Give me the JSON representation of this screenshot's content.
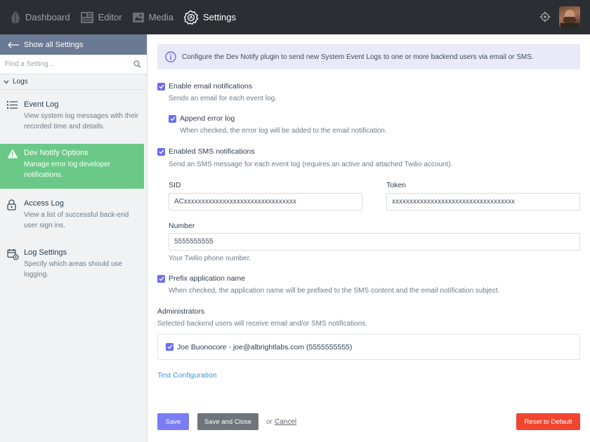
{
  "topbar": {
    "nav": [
      {
        "label": "Dashboard",
        "icon": "leaf-icon"
      },
      {
        "label": "Editor",
        "icon": "newspaper-icon"
      },
      {
        "label": "Media",
        "icon": "image-icon"
      },
      {
        "label": "Settings",
        "icon": "gear-icon"
      }
    ],
    "active_color": "#ffffff"
  },
  "sidebar": {
    "show_all": "Show all Settings",
    "search_placeholder": "Find a Setting...",
    "group": "Logs",
    "items": [
      {
        "title": "Event Log",
        "desc": "View system log messages with their recorded time and details.",
        "icon": "list-icon"
      },
      {
        "title": "Dev Notify Options",
        "desc": "Manage error log developer notifications.",
        "icon": "warning-icon",
        "active": true
      },
      {
        "title": "Access Log",
        "desc": "View a list of successful back-end user sign ins.",
        "icon": "lock-icon"
      },
      {
        "title": "Log Settings",
        "desc": "Specify which areas should use logging.",
        "icon": "calendar-gear-icon"
      }
    ],
    "active_color": "#6ac987"
  },
  "main": {
    "info": "Configure the Dev Notify plugin to send new System Event Logs to one or more backend users via email or SMS.",
    "email": {
      "label": "Enable email notifications",
      "help": "Sends an email for each event log.",
      "checked": true
    },
    "append": {
      "label": "Append error log",
      "help": "When checked, the error log will be added to the email notification.",
      "checked": true
    },
    "sms": {
      "label": "Enabled SMS notifications",
      "help": "Send an SMS message for each event log (requires an active and attached Twilio account).",
      "checked": true
    },
    "sid": {
      "label": "SID",
      "value": "ACxxxxxxxxxxxxxxxxxxxxxxxxxxxxxxxx"
    },
    "token": {
      "label": "Token",
      "value": "xxxxxxxxxxxxxxxxxxxxxxxxxxxxxxxxxxx"
    },
    "number": {
      "label": "Number",
      "value": "5555555555",
      "help": "Your Twilio phone number."
    },
    "prefix": {
      "label": "Prefix application name",
      "help": "When checked, the application name will be prefixed to the SMS content and the email notification subject.",
      "checked": true
    },
    "admins": {
      "label": "Administrators",
      "help": "Selected backend users will receive email and/or SMS notifications.",
      "user": "Joe Buonocore - joe@albrightlabs.com (5555555555)"
    },
    "test_link": "Test Configuration",
    "buttons": {
      "save": "Save",
      "save_close": "Save and Close",
      "or": "or",
      "cancel": "Cancel",
      "reset": "Reset to Default"
    },
    "colors": {
      "accent": "#6a6cf7",
      "save": "#7a7cf5",
      "reset": "#f2452f"
    }
  }
}
